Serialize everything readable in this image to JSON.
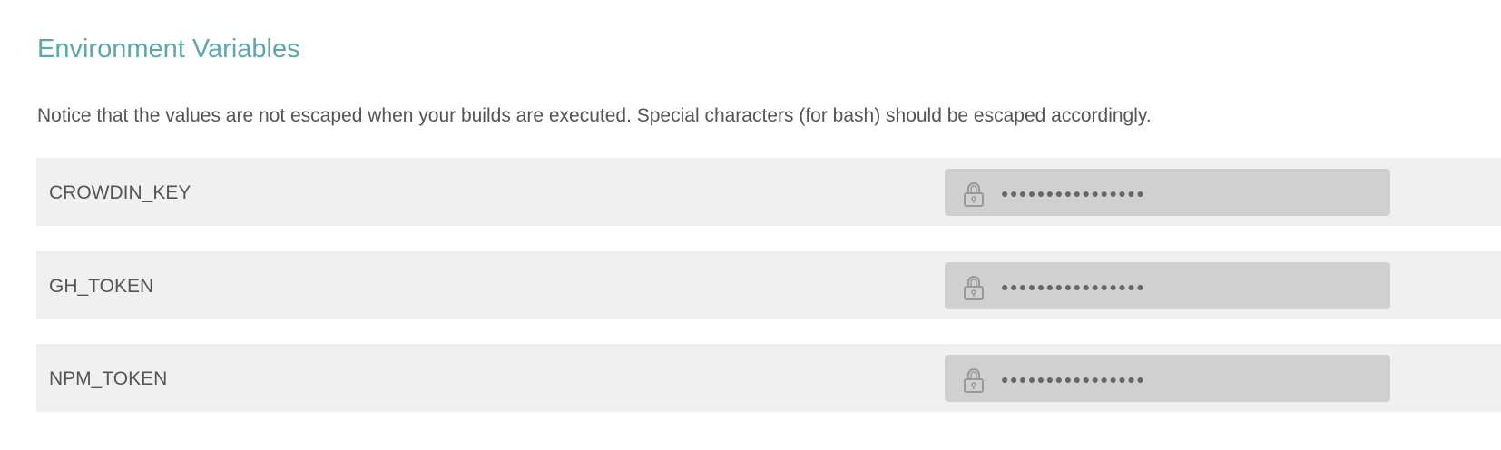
{
  "section": {
    "title": "Environment Variables",
    "notice": "Notice that the values are not escaped when your builds are executed. Special characters (for bash) should be escaped accordingly."
  },
  "variables": [
    {
      "name": "CROWDIN_KEY",
      "value": "●●●●●●●●●●●●●●●●",
      "icon": "lock-icon"
    },
    {
      "name": "GH_TOKEN",
      "value": "●●●●●●●●●●●●●●●●",
      "icon": "lock-icon"
    },
    {
      "name": "NPM_TOKEN",
      "value": "●●●●●●●●●●●●●●●●",
      "icon": "lock-icon"
    }
  ],
  "colors": {
    "title": "#5aa8ad",
    "row_bg": "#f0f0f0",
    "value_bg": "#d0d0d0"
  }
}
